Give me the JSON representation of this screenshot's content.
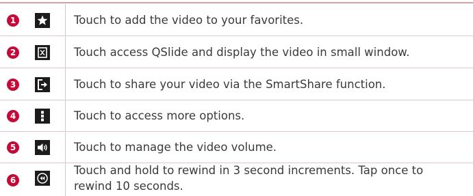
{
  "rows": [
    {
      "number": "1",
      "icon": "star-icon",
      "text": "Touch to add the video to your favorites."
    },
    {
      "number": "2",
      "icon": "qslide-icon",
      "text": "Touch access QSlide and display the video in small window."
    },
    {
      "number": "3",
      "icon": "share-icon",
      "text": "Touch to share your video via the SmartShare function."
    },
    {
      "number": "4",
      "icon": "more-options-icon",
      "text": "Touch to access more options."
    },
    {
      "number": "5",
      "icon": "volume-icon",
      "text": "Touch to manage the video volume."
    },
    {
      "number": "6",
      "icon": "rewind-icon",
      "text_lines": [
        "Touch and hold to rewind in 3 second increments. Tap once to",
        "rewind 10 seconds."
      ]
    }
  ],
  "colors": {
    "badge": "#c50a3a",
    "icon_bg": "#1c1c1c",
    "rule": "#d4a0a8",
    "text": "#3a3a3a"
  }
}
